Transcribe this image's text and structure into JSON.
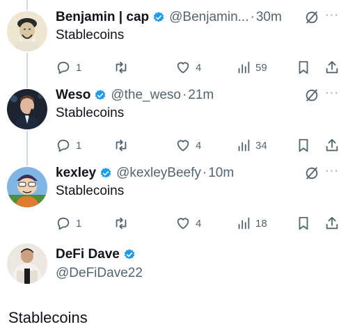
{
  "tweets": [
    {
      "name": "Benjamin | cap",
      "handle": "@Benjamin...",
      "separator": "·",
      "time": "30m",
      "text": "Stablecoins",
      "replies": "1",
      "likes": "4",
      "views": "59"
    },
    {
      "name": "Weso",
      "handle": "@the_weso",
      "separator": "·",
      "time": "21m",
      "text": "Stablecoins",
      "replies": "1",
      "likes": "4",
      "views": "34"
    },
    {
      "name": "kexley",
      "handle": "@kexleyBeefy",
      "separator": "·",
      "time": "10m",
      "text": "Stablecoins",
      "replies": "1",
      "likes": "4",
      "views": "18"
    }
  ],
  "main_tweet": {
    "name": "DeFi Dave",
    "handle": "@DeFiDave22",
    "text": "Stablecoins"
  },
  "more_label": "···",
  "colors": {
    "verified": "#1d9bf0",
    "text": "#0f1419",
    "secondary": "#536471",
    "thread_line": "#cfd9de"
  },
  "icons": {
    "reply": "reply-icon",
    "retweet": "retweet-icon",
    "like": "like-icon",
    "views": "views-icon",
    "bookmark": "bookmark-icon",
    "share": "share-icon",
    "grok": "grok-icon",
    "more": "more-icon",
    "verified": "verified-badge-icon"
  }
}
